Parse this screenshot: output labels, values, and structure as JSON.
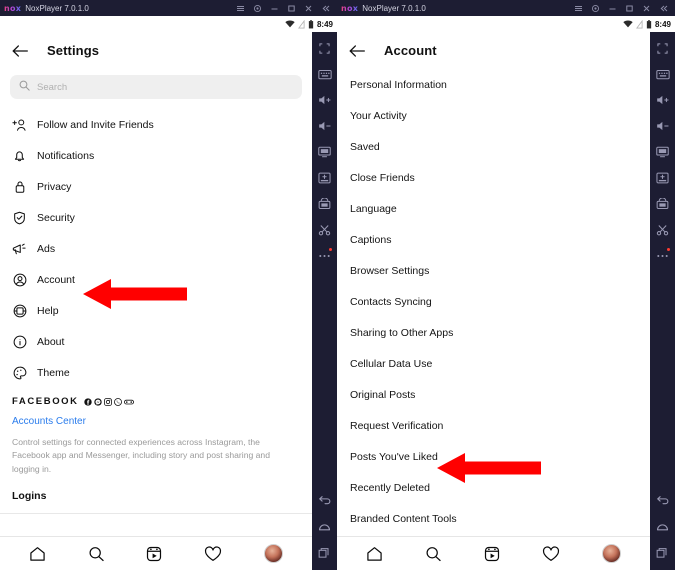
{
  "window": {
    "logo": "nox",
    "title": "NoxPlayer 7.0.1.0",
    "controls": [
      {
        "name": "menu-button",
        "glyph": "☰"
      },
      {
        "name": "settings-gear-button",
        "glyph": "⚙"
      },
      {
        "name": "minimize-button",
        "glyph": "–"
      },
      {
        "name": "maximize-button",
        "glyph": "□"
      },
      {
        "name": "close-button",
        "glyph": "✕"
      },
      {
        "name": "collapse-button",
        "glyph": "«"
      }
    ],
    "status": {
      "wifi_icon": "wifi-icon",
      "signal_icon": "signal-icon",
      "battery_icon": "battery-icon",
      "time": "8:49"
    },
    "tools": [
      {
        "name": "fullscreen-icon",
        "label": "Fullscreen"
      },
      {
        "name": "keyboard-icon",
        "label": "Keyboard"
      },
      {
        "name": "volume-up-icon",
        "label": "Volume Up"
      },
      {
        "name": "volume-down-icon",
        "label": "Volume Down"
      },
      {
        "name": "screenshot-icon",
        "label": "Screenshot"
      },
      {
        "name": "screen-record-icon",
        "label": "Screen Record"
      },
      {
        "name": "apk-install-icon",
        "label": "Install APK"
      },
      {
        "name": "scissors-icon",
        "label": "Cut"
      },
      {
        "name": "more-options-icon",
        "label": "More"
      }
    ],
    "nav": [
      {
        "name": "android-back-icon",
        "label": "Back"
      },
      {
        "name": "android-home-icon",
        "label": "Home"
      },
      {
        "name": "android-recents-icon",
        "label": "Recents"
      }
    ]
  },
  "left_panel": {
    "header": {
      "back": "back-arrow-icon",
      "title": "Settings"
    },
    "search": {
      "placeholder": "Search",
      "value": "",
      "icon": "search-icon"
    },
    "items": [
      {
        "label": "Follow and Invite Friends",
        "icon": "add-person-icon"
      },
      {
        "label": "Notifications",
        "icon": "bell-icon"
      },
      {
        "label": "Privacy",
        "icon": "lock-icon"
      },
      {
        "label": "Security",
        "icon": "shield-check-icon"
      },
      {
        "label": "Ads",
        "icon": "megaphone-icon"
      },
      {
        "label": "Account",
        "icon": "account-circle-icon"
      },
      {
        "label": "Help",
        "icon": "help-icon"
      },
      {
        "label": "About",
        "icon": "info-icon"
      },
      {
        "label": "Theme",
        "icon": "palette-icon"
      }
    ],
    "facebook": {
      "word": "FACEBOOK",
      "icons": [
        "facebook-icon",
        "messenger-icon",
        "instagram-icon",
        "whatsapp-icon",
        "portal-icon"
      ],
      "link": "Accounts Center",
      "description": "Control settings for connected experiences across Instagram, the Facebook app and Messenger, including story and post sharing and logging in.",
      "logins_heading": "Logins"
    }
  },
  "right_panel": {
    "header": {
      "back": "back-arrow-icon",
      "title": "Account"
    },
    "items": [
      {
        "label": "Personal Information"
      },
      {
        "label": "Your Activity"
      },
      {
        "label": "Saved"
      },
      {
        "label": "Close Friends"
      },
      {
        "label": "Language"
      },
      {
        "label": "Captions"
      },
      {
        "label": "Browser Settings"
      },
      {
        "label": "Contacts Syncing"
      },
      {
        "label": "Sharing to Other Apps"
      },
      {
        "label": "Cellular Data Use"
      },
      {
        "label": "Original Posts"
      },
      {
        "label": "Request Verification"
      },
      {
        "label": "Posts You've Liked"
      },
      {
        "label": "Recently Deleted"
      },
      {
        "label": "Branded Content Tools"
      }
    ]
  },
  "bottom_nav": [
    {
      "name": "home-icon",
      "label": "Home"
    },
    {
      "name": "search-icon",
      "label": "Search"
    },
    {
      "name": "reels-icon",
      "label": "Reels"
    },
    {
      "name": "heart-icon",
      "label": "Activity"
    },
    {
      "name": "profile-avatar",
      "label": "Profile"
    }
  ],
  "annotations": [
    {
      "name": "red-arrow-account",
      "points_to": "Account",
      "color": "#FF0000"
    },
    {
      "name": "red-arrow-posts-youve-liked",
      "points_to": "Posts You've Liked",
      "color": "#FF0000"
    }
  ]
}
